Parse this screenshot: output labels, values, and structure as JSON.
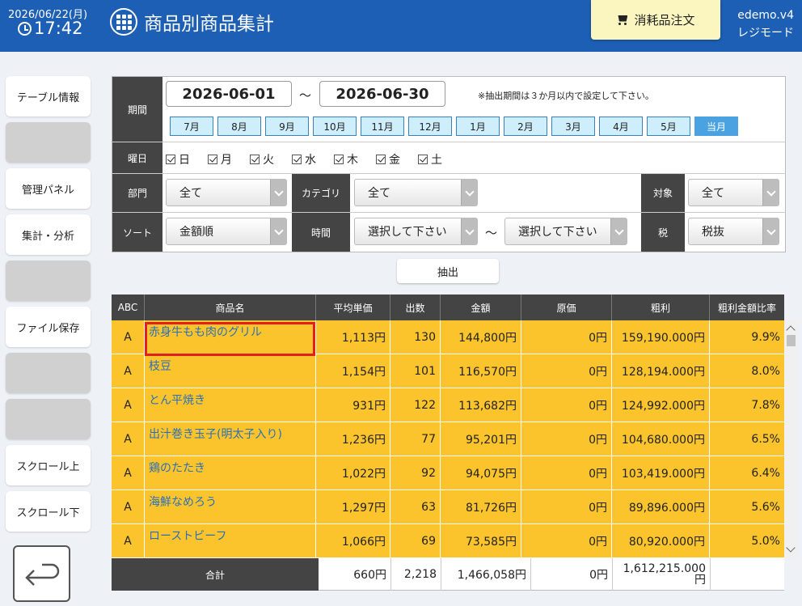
{
  "header": {
    "date": "2026/06/22(月)",
    "time": "17:42",
    "title": "商品別商品集計",
    "order_button": "消耗品注文",
    "app_name": "edemo.v4",
    "mode": "レジモード",
    "color": "#1c5fb4"
  },
  "sidebar": {
    "items": [
      {
        "label": "テーブル情報"
      },
      {
        "label": ""
      },
      {
        "label": "管理パネル"
      },
      {
        "label": "集計・分析"
      },
      {
        "label": ""
      },
      {
        "label": "ファイル保存"
      },
      {
        "label": ""
      },
      {
        "label": ""
      },
      {
        "label": "スクロール上"
      },
      {
        "label": "スクロール下"
      }
    ],
    "back_icon": "return-arrow-icon"
  },
  "filters": {
    "period_label": "期間",
    "start_date": "2026-06-01",
    "tilde": "～",
    "end_date": "2026-06-30",
    "note": "※抽出期間は３か月以内で設定して下さい。",
    "months": [
      "7月",
      "8月",
      "9月",
      "10月",
      "11月",
      "12月",
      "1月",
      "2月",
      "3月",
      "4月",
      "5月",
      "当月"
    ],
    "weekday_label": "曜日",
    "weekdays": [
      "日",
      "月",
      "火",
      "水",
      "木",
      "金",
      "土"
    ],
    "dept_label": "部門",
    "dept_value": "全て",
    "category_label": "カテゴリ",
    "category_value": "全て",
    "target_label": "対象",
    "target_value": "全て",
    "sort_label": "ソート",
    "sort_value": "金額順",
    "time_label": "時間",
    "time_from": "選択して下さい",
    "time_to": "選択して下さい",
    "tax_label": "税",
    "tax_value": "税抜",
    "extract_button": "抽出"
  },
  "table": {
    "columns": [
      "ABC",
      "商品名",
      "平均単価",
      "出数",
      "金額",
      "原価",
      "粗利",
      "粗利金額比率"
    ],
    "rows": [
      {
        "abc": "A",
        "name": "赤身牛もも肉のグリル",
        "avg": "1,113円",
        "qty": "130",
        "amount": "144,800円",
        "cost": "0円",
        "profit": "159,190.000円",
        "ratio": "9.9%"
      },
      {
        "abc": "A",
        "name": "枝豆",
        "avg": "1,154円",
        "qty": "101",
        "amount": "116,570円",
        "cost": "0円",
        "profit": "128,194.000円",
        "ratio": "8.0%"
      },
      {
        "abc": "A",
        "name": "とん平焼き",
        "avg": "931円",
        "qty": "122",
        "amount": "113,682円",
        "cost": "0円",
        "profit": "124,992.000円",
        "ratio": "7.8%"
      },
      {
        "abc": "A",
        "name": "出汁巻き玉子(明太子入り)",
        "avg": "1,236円",
        "qty": "77",
        "amount": "95,201円",
        "cost": "0円",
        "profit": "104,680.000円",
        "ratio": "6.5%"
      },
      {
        "abc": "A",
        "name": "鶏のたたき",
        "avg": "1,022円",
        "qty": "92",
        "amount": "94,075円",
        "cost": "0円",
        "profit": "103,419.000円",
        "ratio": "6.4%"
      },
      {
        "abc": "A",
        "name": "海鮮なめろう",
        "avg": "1,297円",
        "qty": "63",
        "amount": "81,726円",
        "cost": "0円",
        "profit": "89,896.000円",
        "ratio": "5.6%"
      },
      {
        "abc": "A",
        "name": "ローストビーフ",
        "avg": "1,066円",
        "qty": "69",
        "amount": "73,585円",
        "cost": "0円",
        "profit": "80,920.000円",
        "ratio": "5.0%"
      }
    ],
    "total": {
      "label": "合計",
      "avg": "660円",
      "qty": "2,218",
      "amount": "1,466,058円",
      "cost": "0円",
      "profit": "1,612,215.000円",
      "ratio": ""
    },
    "row_color": "#fbc42c",
    "selected_row": 0
  }
}
